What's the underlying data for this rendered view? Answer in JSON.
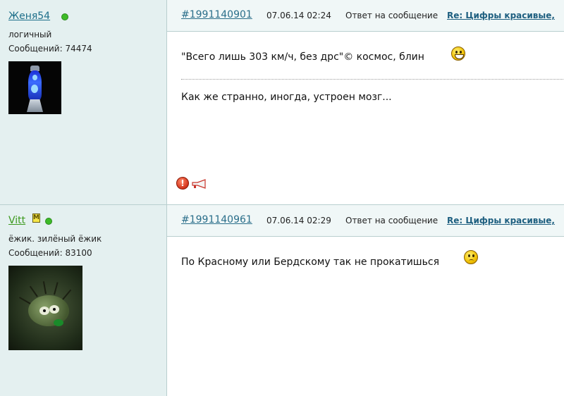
{
  "posts": [
    {
      "user": {
        "name": "Женя54",
        "rank": "логичный",
        "messages_label": "Сообщений: 74474",
        "online": true,
        "name_color": "#1e6f8a",
        "avatar": "lava-lamp-avatar"
      },
      "header": {
        "id": "#1991140901",
        "date": "07.06.14 02:24",
        "reply_label": "Ответ на сообщение",
        "thread": "Re: Цифры красивые,"
      },
      "body": {
        "line1": "\"Всего лишь 303 км/ч, без дрс\"© космос, блин",
        "line2": "Как же странно, иногда, устроен мозг..."
      },
      "smiley": "grin-smiley-icon"
    },
    {
      "user": {
        "name": "Vitt",
        "rank": "ёжик. зилёный ёжик",
        "messages_label": "Сообщений: 83100",
        "online": true,
        "moderator": true,
        "name_color": "#3d9a1f",
        "avatar": "hedgehog-avatar"
      },
      "header": {
        "id": "#1991140961",
        "date": "07.06.14 02:29",
        "reply_label": "Ответ на сообщение",
        "thread": "Re: Цифры красивые,"
      },
      "body": {
        "line1": "По Красному или Бердскому так не прокатишься"
      },
      "smiley": "sad-smiley-icon"
    }
  ],
  "colors": {
    "sidebar_bg": "#e4f0f0",
    "header_bg": "#f0f7f7",
    "link": "#2a6e8a",
    "online": "#3dbb28"
  }
}
